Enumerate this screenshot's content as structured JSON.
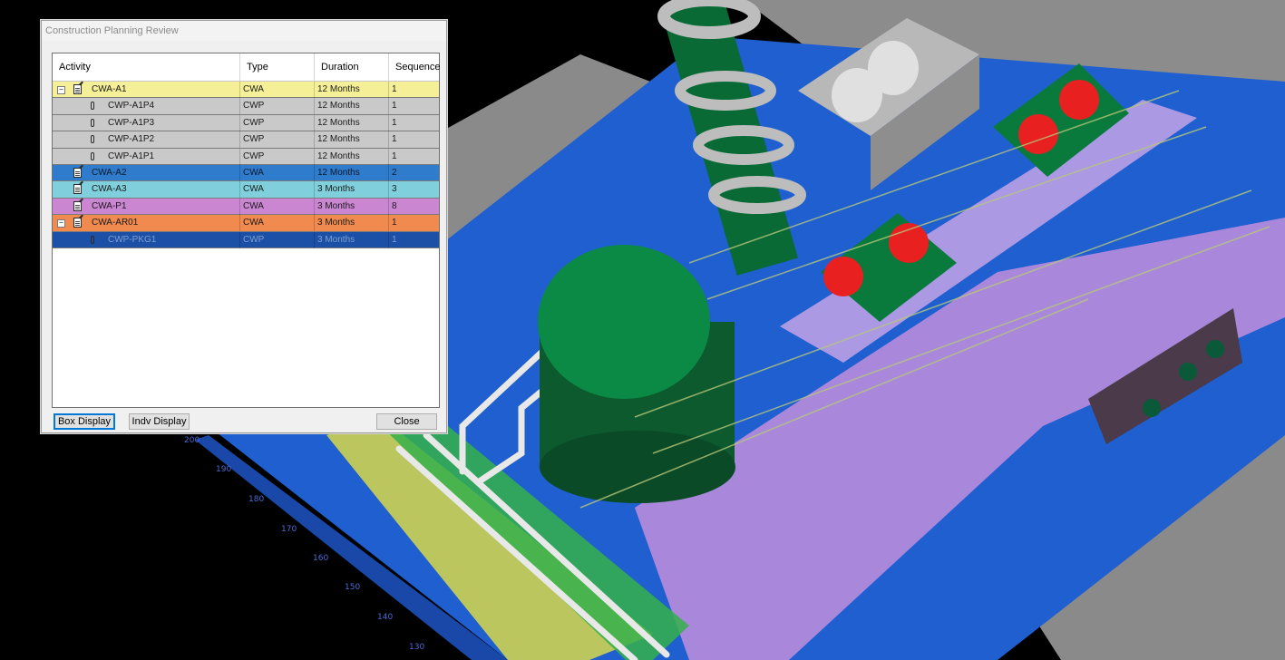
{
  "dialog": {
    "title": "Construction Planning Review",
    "columns": [
      "Activity",
      "Type",
      "Duration",
      "Sequence"
    ],
    "rows": [
      {
        "activity": "CWA-A1",
        "type": "CWA",
        "duration": "12 Months",
        "sequence": "1",
        "icon": "document-icon",
        "expander": "−",
        "color": "#f5f098",
        "text_color": "#1a1a1a"
      },
      {
        "activity": "CWP-A1P4",
        "type": "CWP",
        "duration": "12 Months",
        "sequence": "1",
        "icon": "paperclip-icon",
        "color": "#c9c9c9",
        "text_color": "#1a1a1a"
      },
      {
        "activity": "CWP-A1P3",
        "type": "CWP",
        "duration": "12 Months",
        "sequence": "1",
        "icon": "paperclip-icon",
        "color": "#c9c9c9",
        "text_color": "#1a1a1a"
      },
      {
        "activity": "CWP-A1P2",
        "type": "CWP",
        "duration": "12 Months",
        "sequence": "1",
        "icon": "paperclip-icon",
        "color": "#c9c9c9",
        "text_color": "#1a1a1a"
      },
      {
        "activity": "CWP-A1P1",
        "type": "CWP",
        "duration": "12 Months",
        "sequence": "1",
        "icon": "paperclip-icon",
        "color": "#c9c9c9",
        "text_color": "#1a1a1a"
      },
      {
        "activity": "CWA-A2",
        "type": "CWA",
        "duration": "12 Months",
        "sequence": "2",
        "icon": "document-icon",
        "color": "#2f7bcc",
        "text_color": "#0d1a2a"
      },
      {
        "activity": "CWA-A3",
        "type": "CWA",
        "duration": "3 Months",
        "sequence": "3",
        "icon": "document-icon",
        "color": "#7fd0dc",
        "text_color": "#1a1a1a"
      },
      {
        "activity": "CWA-P1",
        "type": "CWA",
        "duration": "3 Months",
        "sequence": "8",
        "icon": "document-icon",
        "color": "#cb86d2",
        "text_color": "#1a1a1a"
      },
      {
        "activity": "CWA-AR01",
        "type": "CWA",
        "duration": "3 Months",
        "sequence": "1",
        "icon": "document-icon",
        "expander": "−",
        "color": "#f08a4e",
        "text_color": "#1a1a1a"
      },
      {
        "activity": "CWP-PKG1",
        "type": "CWP",
        "duration": "3 Months",
        "sequence": "1",
        "icon": "paperclip-icon",
        "color": "#1c4fa6",
        "text_color": "#7f9fd0"
      }
    ],
    "buttons": {
      "box_display": "Box Display",
      "indv_display": "Indv Display",
      "close": "Close"
    }
  },
  "viewport": {
    "axis_labels": [
      "200",
      "190",
      "180",
      "170",
      "160",
      "150",
      "140",
      "130"
    ],
    "colors": {
      "background": "#000000",
      "floor": "#1f5fd0",
      "slab": "#8a8a8a",
      "vessel": "#0a7a3c",
      "valve": "#e82020",
      "zone_pink": "#d896e0"
    }
  }
}
